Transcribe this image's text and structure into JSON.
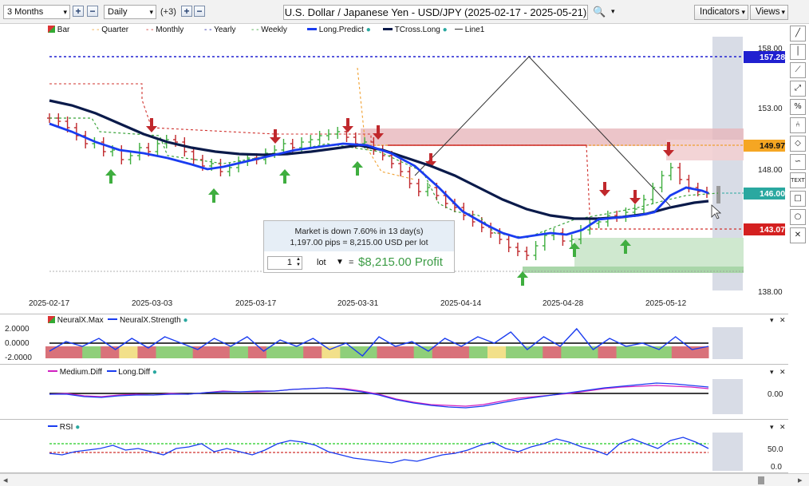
{
  "toolbar": {
    "period": "3 Months",
    "interval": "Daily",
    "extra_count": "(+3)",
    "title": "U.S. Dollar / Japanese Yen - USD/JPY (2025-02-17 - 2025-05-21)",
    "indicators_label": "Indicators",
    "views_label": "Views",
    "plus": "+",
    "minus": "−",
    "caret": "▾",
    "search_glyph": "🔍"
  },
  "palette": {
    "tools": [
      {
        "name": "line-tool-icon",
        "glyph": "╱"
      },
      {
        "name": "vertical-line-tool-icon",
        "glyph": "│"
      },
      {
        "name": "trendline-tool-icon",
        "glyph": "⟋"
      },
      {
        "name": "ray-tool-icon",
        "glyph": "⤢"
      },
      {
        "name": "fibonacci-tool-icon",
        "glyph": "%"
      },
      {
        "name": "pitchfork-tool-icon",
        "glyph": "⑃"
      },
      {
        "name": "callout-tool-icon",
        "glyph": "◇"
      },
      {
        "name": "wave-tool-icon",
        "glyph": "∽"
      },
      {
        "name": "text-tool-icon",
        "glyph": "TEXT"
      },
      {
        "name": "rectangle-tool-icon",
        "glyph": "□"
      },
      {
        "name": "ellipse-tool-icon",
        "glyph": "○"
      },
      {
        "name": "delete-tool-icon",
        "glyph": "✕"
      }
    ]
  },
  "price_chart": {
    "legend": [
      {
        "label": "Bar",
        "color": "#c0392b"
      },
      {
        "label": "Quarter",
        "color": "#f0a030"
      },
      {
        "label": "Monthly",
        "color": "#d0312d"
      },
      {
        "label": "Yearly",
        "color": "#1a1aa0"
      },
      {
        "label": "Weekly",
        "color": "#3aa33a"
      },
      {
        "label": "Long.Predict",
        "color": "#1a3cf0"
      },
      {
        "label": "TCross.Long",
        "color": "#0a1a4a"
      },
      {
        "label": "Line1",
        "color": "#333333"
      }
    ],
    "price_labels": [
      {
        "text": "157.28",
        "bg": "#2020d0"
      },
      {
        "text": "149.97",
        "bg": "#f5a623"
      },
      {
        "text": "146.00",
        "bg": "#2aa8a0"
      },
      {
        "text": "143.07",
        "bg": "#d42020"
      }
    ],
    "y_ticks": [
      "158.00",
      "153.00",
      "148.00",
      "138.00"
    ],
    "x_ticks": [
      "2025-02-17",
      "2025-03-03",
      "2025-03-17",
      "2025-03-31",
      "2025-04-14",
      "2025-04-28",
      "2025-05-12"
    ],
    "info": {
      "line1": "Market is down 7.60% in 13 day(s)",
      "line2": "1,197.00 pips = 8,215.00 USD per lot",
      "lot_value": "1",
      "lot_label": "lot",
      "equals": "=",
      "profit": "$8,215.00 Profit"
    }
  },
  "neuralx_pane": {
    "legend": [
      "NeuralX.Max",
      "NeuralX.Strength"
    ],
    "y_ticks": [
      "2.0000",
      "0.0000",
      "-2.0000"
    ]
  },
  "diff_pane": {
    "legend": [
      "Medium.Diff",
      "Long.Diff"
    ],
    "y_ticks": [
      "0.00"
    ]
  },
  "rsi_pane": {
    "legend": [
      "RSI"
    ],
    "y_ticks": [
      "50.0",
      "0.0"
    ]
  },
  "pane_controls": {
    "collapse": "▾",
    "close": "✕"
  },
  "scroll": {
    "left_arrow": "◂",
    "right_arrow": "▸"
  },
  "colors": {
    "bull": "#3fae3f",
    "bear": "#c0282c",
    "long_predict": "#1a3cf0",
    "tcross": "#0a1a4a",
    "yearly": "#2020d0",
    "accent_green": "#3c9c45"
  }
}
